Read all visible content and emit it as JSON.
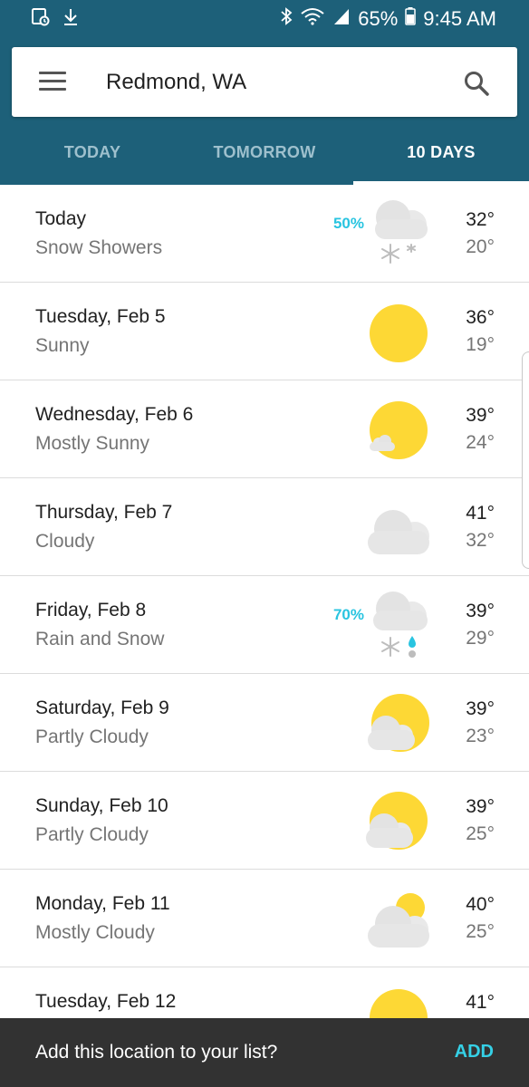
{
  "status_bar": {
    "battery": "65%",
    "time": "9:45 AM",
    "icons": [
      "screenshot-icon",
      "download-icon",
      "bluetooth-icon",
      "wifi-icon",
      "signal-icon",
      "battery-icon"
    ]
  },
  "search": {
    "location": "Redmond, WA"
  },
  "tabs": [
    {
      "label": "TODAY",
      "active": false
    },
    {
      "label": "TOMORROW",
      "active": false
    },
    {
      "label": "10 DAYS",
      "active": true
    }
  ],
  "days": [
    {
      "day": "Today",
      "condition": "Snow Showers",
      "precip": "50%",
      "high": "32°",
      "low": "20°",
      "icon": "snow-showers-icon"
    },
    {
      "day": "Tuesday, Feb 5",
      "condition": "Sunny",
      "precip": "",
      "high": "36°",
      "low": "19°",
      "icon": "sunny-icon"
    },
    {
      "day": "Wednesday, Feb 6",
      "condition": "Mostly Sunny",
      "precip": "",
      "high": "39°",
      "low": "24°",
      "icon": "mostly-sunny-icon"
    },
    {
      "day": "Thursday, Feb 7",
      "condition": "Cloudy",
      "precip": "",
      "high": "41°",
      "low": "32°",
      "icon": "cloudy-icon"
    },
    {
      "day": "Friday, Feb 8",
      "condition": "Rain and Snow",
      "precip": "70%",
      "high": "39°",
      "low": "29°",
      "icon": "rain-and-snow-icon"
    },
    {
      "day": "Saturday, Feb 9",
      "condition": "Partly Cloudy",
      "precip": "",
      "high": "39°",
      "low": "23°",
      "icon": "partly-cloudy-icon"
    },
    {
      "day": "Sunday, Feb 10",
      "condition": "Partly Cloudy",
      "precip": "",
      "high": "39°",
      "low": "25°",
      "icon": "partly-cloudy-icon"
    },
    {
      "day": "Monday, Feb 11",
      "condition": "Mostly Cloudy",
      "precip": "",
      "high": "40°",
      "low": "25°",
      "icon": "mostly-cloudy-icon"
    },
    {
      "day": "Tuesday, Feb 12",
      "condition": "",
      "precip": "",
      "high": "41°",
      "low": "",
      "icon": "sunny-icon"
    }
  ],
  "snackbar": {
    "message": "Add this location to your list?",
    "action": "ADD"
  },
  "colors": {
    "header": "#1d6079",
    "accent": "#29c4e0",
    "sun": "#fdd835",
    "cloud": "#e6e6e6"
  }
}
